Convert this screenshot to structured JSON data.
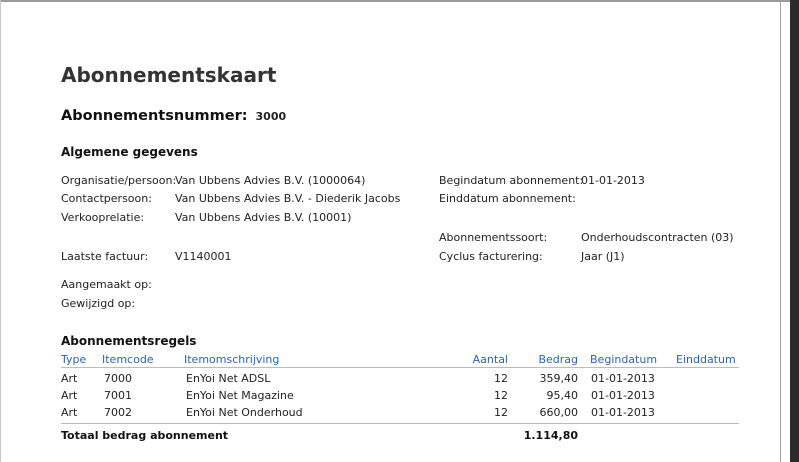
{
  "document": {
    "title": "Abonnementskaart",
    "number_label": "Abonnementsnummer:",
    "number_value": "3000"
  },
  "general": {
    "heading": "Algemene gegevens",
    "left": [
      {
        "label": "Organisatie/persoon:",
        "value": "Van Ubbens Advies B.V. (1000064)"
      },
      {
        "label": "Contactpersoon:",
        "value": "Van Ubbens Advies B.V. - Diederik Jacobs"
      },
      {
        "label": "Verkooprelatie:",
        "value": "Van Ubbens Advies B.V. (10001)"
      },
      {
        "label": "Laatste factuur:",
        "value": "V1140001"
      },
      {
        "label": "Aangemaakt op:",
        "value": ""
      },
      {
        "label": "Gewijzigd op:",
        "value": ""
      }
    ],
    "right": [
      {
        "label": "Begindatum abonnement:",
        "value": "01-01-2013"
      },
      {
        "label": "Einddatum abonnement:",
        "value": ""
      },
      {
        "label": "Abonnementssoort:",
        "value": "Onderhoudscontracten (03)"
      },
      {
        "label": "Cyclus facturering:",
        "value": "Jaar (J1)"
      }
    ]
  },
  "lines": {
    "heading": "Abonnementsregels",
    "columns": [
      "Type",
      "Itemcode",
      "Itemomschrijving",
      "Aantal",
      "Bedrag",
      "Begindatum",
      "Einddatum"
    ],
    "rows": [
      [
        "Art",
        "7000",
        "EnYoi Net ADSL",
        "12",
        "359,40",
        "01-01-2013",
        ""
      ],
      [
        "Art",
        "7001",
        "EnYoi Net Magazine",
        "12",
        "95,40",
        "01-01-2013",
        ""
      ],
      [
        "Art",
        "7002",
        "EnYoi Net Onderhoud",
        "12",
        "660,00",
        "01-01-2013",
        ""
      ]
    ],
    "total_label": "Totaal bedrag abonnement",
    "total_value": "1.114,80"
  }
}
